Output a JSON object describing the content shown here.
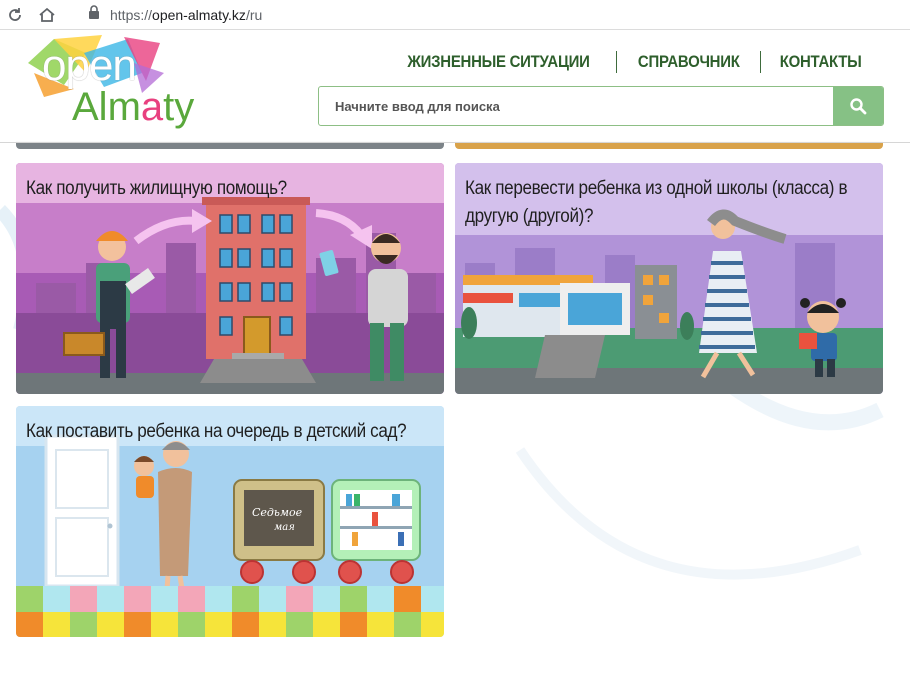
{
  "browser": {
    "url_scheme": "https://",
    "url_host": "open-almaty.kz",
    "url_path": "/ru"
  },
  "logo": {
    "open_text": "open",
    "almaty_start": "Alm",
    "almaty_accent": "a",
    "almaty_end": "ty"
  },
  "nav": {
    "items": [
      {
        "label": "ЖИЗНЕННЫЕ СИТУАЦИИ"
      },
      {
        "label": "СПРАВОЧНИК"
      },
      {
        "label": "КОНТАКТЫ"
      }
    ]
  },
  "search": {
    "placeholder": "Начните ввод для поиска"
  },
  "cards": [
    {
      "title": "Как получить жилищную помощь?"
    },
    {
      "title": "Как перевести ребенка из одной школы (класса) в другую (другой)?"
    },
    {
      "title": "Как поставить ребенка на очередь в детский сад?"
    }
  ],
  "colors": {
    "nav_text": "#2e5f2c",
    "search_button": "#86c185",
    "logo_green": "#5aa83c"
  }
}
